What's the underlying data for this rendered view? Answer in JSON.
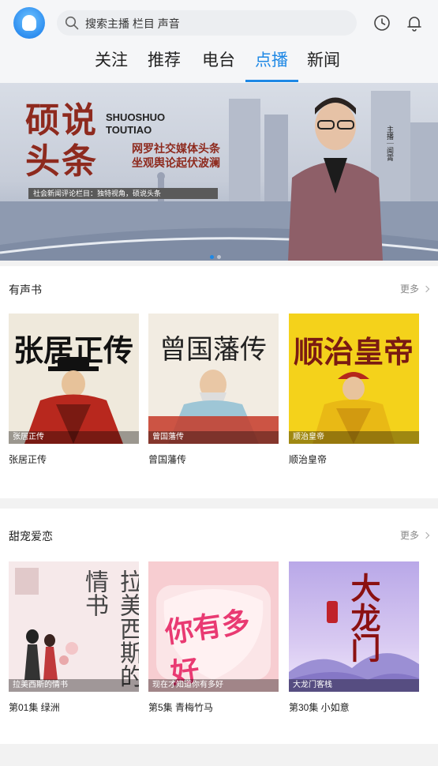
{
  "search": {
    "placeholder": "搜索主播 栏目 声音"
  },
  "tabs": [
    {
      "label": "关注"
    },
    {
      "label": "推荐"
    },
    {
      "label": "电台"
    },
    {
      "label": "点播",
      "active": true
    },
    {
      "label": "新闻"
    }
  ],
  "banner": {
    "title": "硕说头条",
    "title_en": "SHUOSHUO TOUTIAO",
    "subtitle_line1": "网罗社交媒体头条",
    "subtitle_line2": "坐观舆论起伏波澜",
    "strip": "社会新闻评论栏目：独特视角，硕说头条",
    "host": "主播｜闻霄"
  },
  "sections": [
    {
      "title": "有声书",
      "more": "更多",
      "items": [
        {
          "cover_title": "张居正传",
          "overlay": "张居正传",
          "caption": "张居正传"
        },
        {
          "cover_title": "曾国藩传",
          "overlay": "曾国藩传",
          "caption": "曾国藩传"
        },
        {
          "cover_title": "顺治皇帝",
          "overlay": "顺治皇帝",
          "caption": "顺治皇帝"
        }
      ]
    },
    {
      "title": "甜宠爱恋",
      "more": "更多",
      "items": [
        {
          "cover_title": "拉美西斯的情书",
          "overlay": "拉美西斯的情书",
          "caption": "第01集 绿洲"
        },
        {
          "cover_title": "你有多好",
          "overlay": "现在才知道你有多好",
          "caption": "第5集 青梅竹马"
        },
        {
          "cover_title": "大龙门",
          "overlay": "大龙门客栈",
          "caption": "第30集 小如意"
        }
      ]
    }
  ],
  "colors": {
    "accent": "#1e88e5",
    "title_red": "#8e2a1e"
  },
  "icons": [
    "search-icon",
    "history-clock-icon",
    "bell-icon"
  ]
}
